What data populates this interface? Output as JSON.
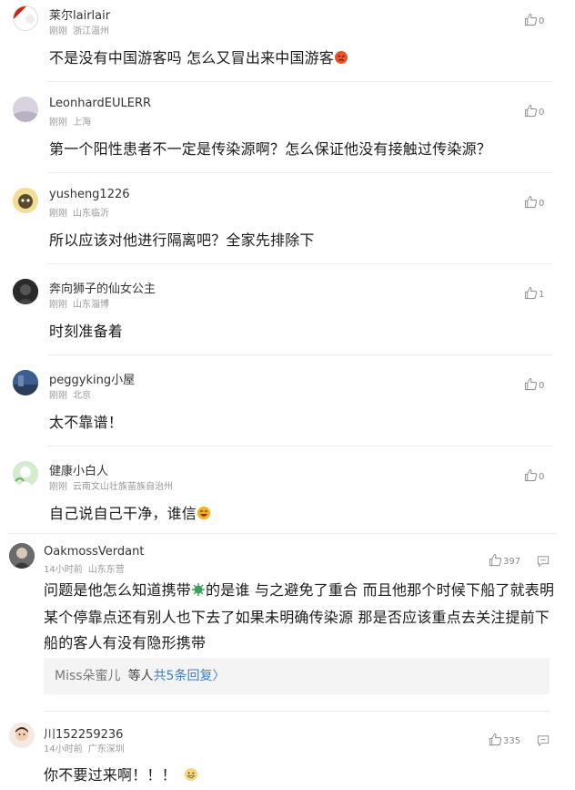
{
  "comments": [
    {
      "user": "莱尔lairlair",
      "time": "刚刚",
      "location": "浙江温州",
      "text": "不是没有中国游客吗 怎么又冒出来中国游客",
      "likes": "0"
    },
    {
      "user": "LeonhardEULERR",
      "time": "刚刚",
      "location": "上海",
      "text": "第一个阳性患者不一定是传染源啊？怎么保证他没有接触过传染源？",
      "likes": "0"
    },
    {
      "user": "yusheng1226",
      "time": "刚刚",
      "location": "山东临沂",
      "text": "所以应该对他进行隔离吧？全家先排除下",
      "likes": "0"
    },
    {
      "user": "奔向狮子的仙女公主",
      "time": "刚刚",
      "location": "山东淄博",
      "text": "时刻准备着",
      "likes": "1"
    },
    {
      "user": "peggyking小屋",
      "time": "刚刚",
      "location": "北京",
      "text": "太不靠谱！",
      "likes": "0"
    },
    {
      "user": "健康小白人",
      "time": "刚刚",
      "location": "云南文山壮族苗族自治州",
      "text": "自己说自己干净，谁信",
      "likes": "0"
    },
    {
      "user": "OakmossVerdant",
      "time": "14小时前",
      "location": "山东东营",
      "text_a": "问题是他怎么知道携带",
      "text_b": "的是谁 与之避免了重合 而且他那个时候下船了就表明某个停靠点还有别人也下去了如果未明确传染源 那是否应该重点去关注提前下船的客人有没有隐形携带",
      "likes": "397",
      "replies": {
        "name": "Miss朵蜜儿",
        "mid": "等人",
        "link": "共5条回复",
        "chevron": "〉"
      }
    },
    {
      "user": "川152259236",
      "time": "14小时前",
      "location": "广东深圳",
      "text": "你不要过来啊！！！",
      "likes": "335"
    }
  ],
  "icons": {
    "like": "thumbs-up-icon",
    "reply": "comment-bubble-icon"
  },
  "colors": {
    "link": "#3d7fc4",
    "meta": "#999999",
    "divider": "#ededed"
  }
}
